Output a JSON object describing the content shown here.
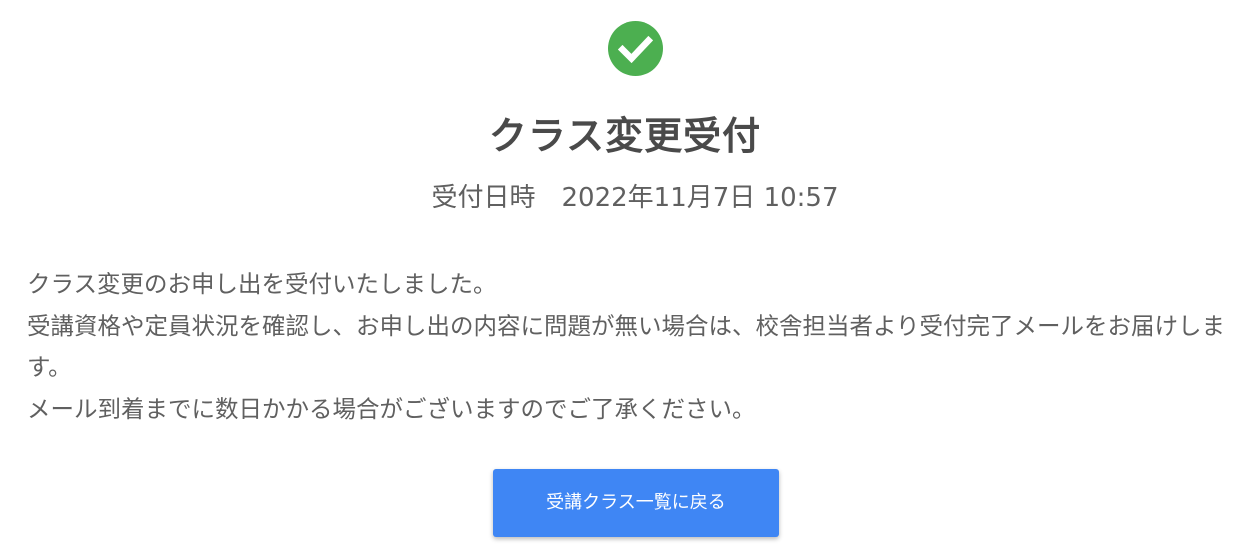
{
  "status": {
    "icon": "check-circle-icon",
    "color": "#4caf50"
  },
  "header": {
    "title": "クラス変更受付",
    "received_label": "受付日時",
    "received_datetime": "2022年11月7日 10:57"
  },
  "message": {
    "lines": [
      "クラス変更のお申し出を受付いたしました。",
      "受講資格や定員状況を確認し、お申し出の内容に問題が無い場合は、校舎担当者より受付完了メールをお届けします。",
      "メール到着までに数日かかる場合がございますのでご了承ください。"
    ]
  },
  "actions": {
    "back_label": "受講クラス一覧に戻る",
    "button_color": "#3f86f4"
  }
}
